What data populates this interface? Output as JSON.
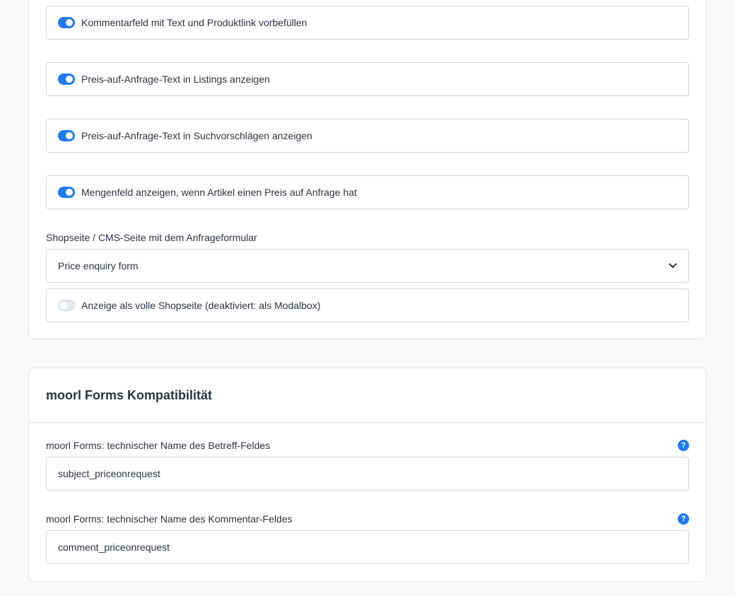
{
  "toggles": [
    {
      "label": "Kommentarfeld mit Text und Produktlink vorbefüllen",
      "enabled": true
    },
    {
      "label": "Preis-auf-Anfrage-Text in Listings anzeigen",
      "enabled": true
    },
    {
      "label": "Preis-auf-Anfrage-Text in Suchvorschlägen anzeigen",
      "enabled": true
    },
    {
      "label": "Mengenfeld anzeigen, wenn Artikel einen Preis auf Anfrage hat",
      "enabled": true
    }
  ],
  "page_select": {
    "label": "Shopseite / CMS-Seite mit dem Anfrageformular",
    "value": "Price enquiry form"
  },
  "fullpage_toggle": {
    "label": "Anzeige als volle Shopseite (deaktiviert: als Modalbox)",
    "enabled": false
  },
  "moorl_section": {
    "title": "moorl Forms Kompatibilität",
    "subject_field": {
      "label": "moorl Forms: technischer Name des Betreff-Feldes",
      "value": "subject_priceonrequest"
    },
    "comment_field": {
      "label": "moorl Forms: technischer Name des Kommentar-Feldes",
      "value": "comment_priceonrequest"
    },
    "help_glyph": "?"
  },
  "colors": {
    "accent": "#1f7af0",
    "border": "#d1d9e0",
    "background": "#f9fafb"
  },
  "icons": [
    "chevron-down-icon",
    "help-icon"
  ]
}
